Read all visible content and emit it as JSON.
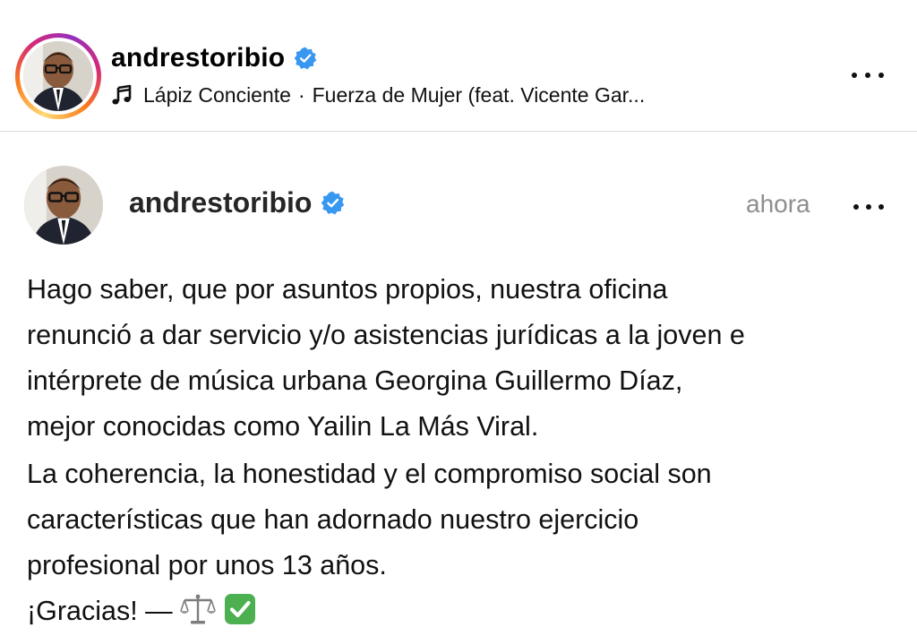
{
  "header": {
    "username": "andrestoribio",
    "music": {
      "artist": "Lápiz Conciente",
      "separator": "·",
      "song": "Fuerza de Mujer (feat. Vicente Gar..."
    }
  },
  "post": {
    "username": "andrestoribio",
    "time": "ahora",
    "paragraphs": [
      [
        "Hago saber, que por asuntos propios, nuestra oficina",
        "renunció a dar servicio y/o asistencias jurídicas a la joven e",
        "intérprete de música urbana Georgina Guillermo Díaz,",
        "mejor conocidas como Yailin La Más Viral."
      ],
      [
        "La coherencia, la honestidad y el compromiso social son",
        "características que han adornado nuestro ejercicio",
        "profesional por unos 13 años."
      ]
    ],
    "closing": "¡Gracias! —"
  },
  "icons": {
    "verified": "verified-badge-icon",
    "music": "music-note-icon",
    "more": "more-options-icon",
    "scales": "balance-scale-emoji",
    "check": "check-mark-button-emoji"
  },
  "colors": {
    "verified": "#3897f0",
    "time": "#8e8e8e",
    "divider": "#dbdbdb",
    "check": "#4caf50"
  }
}
